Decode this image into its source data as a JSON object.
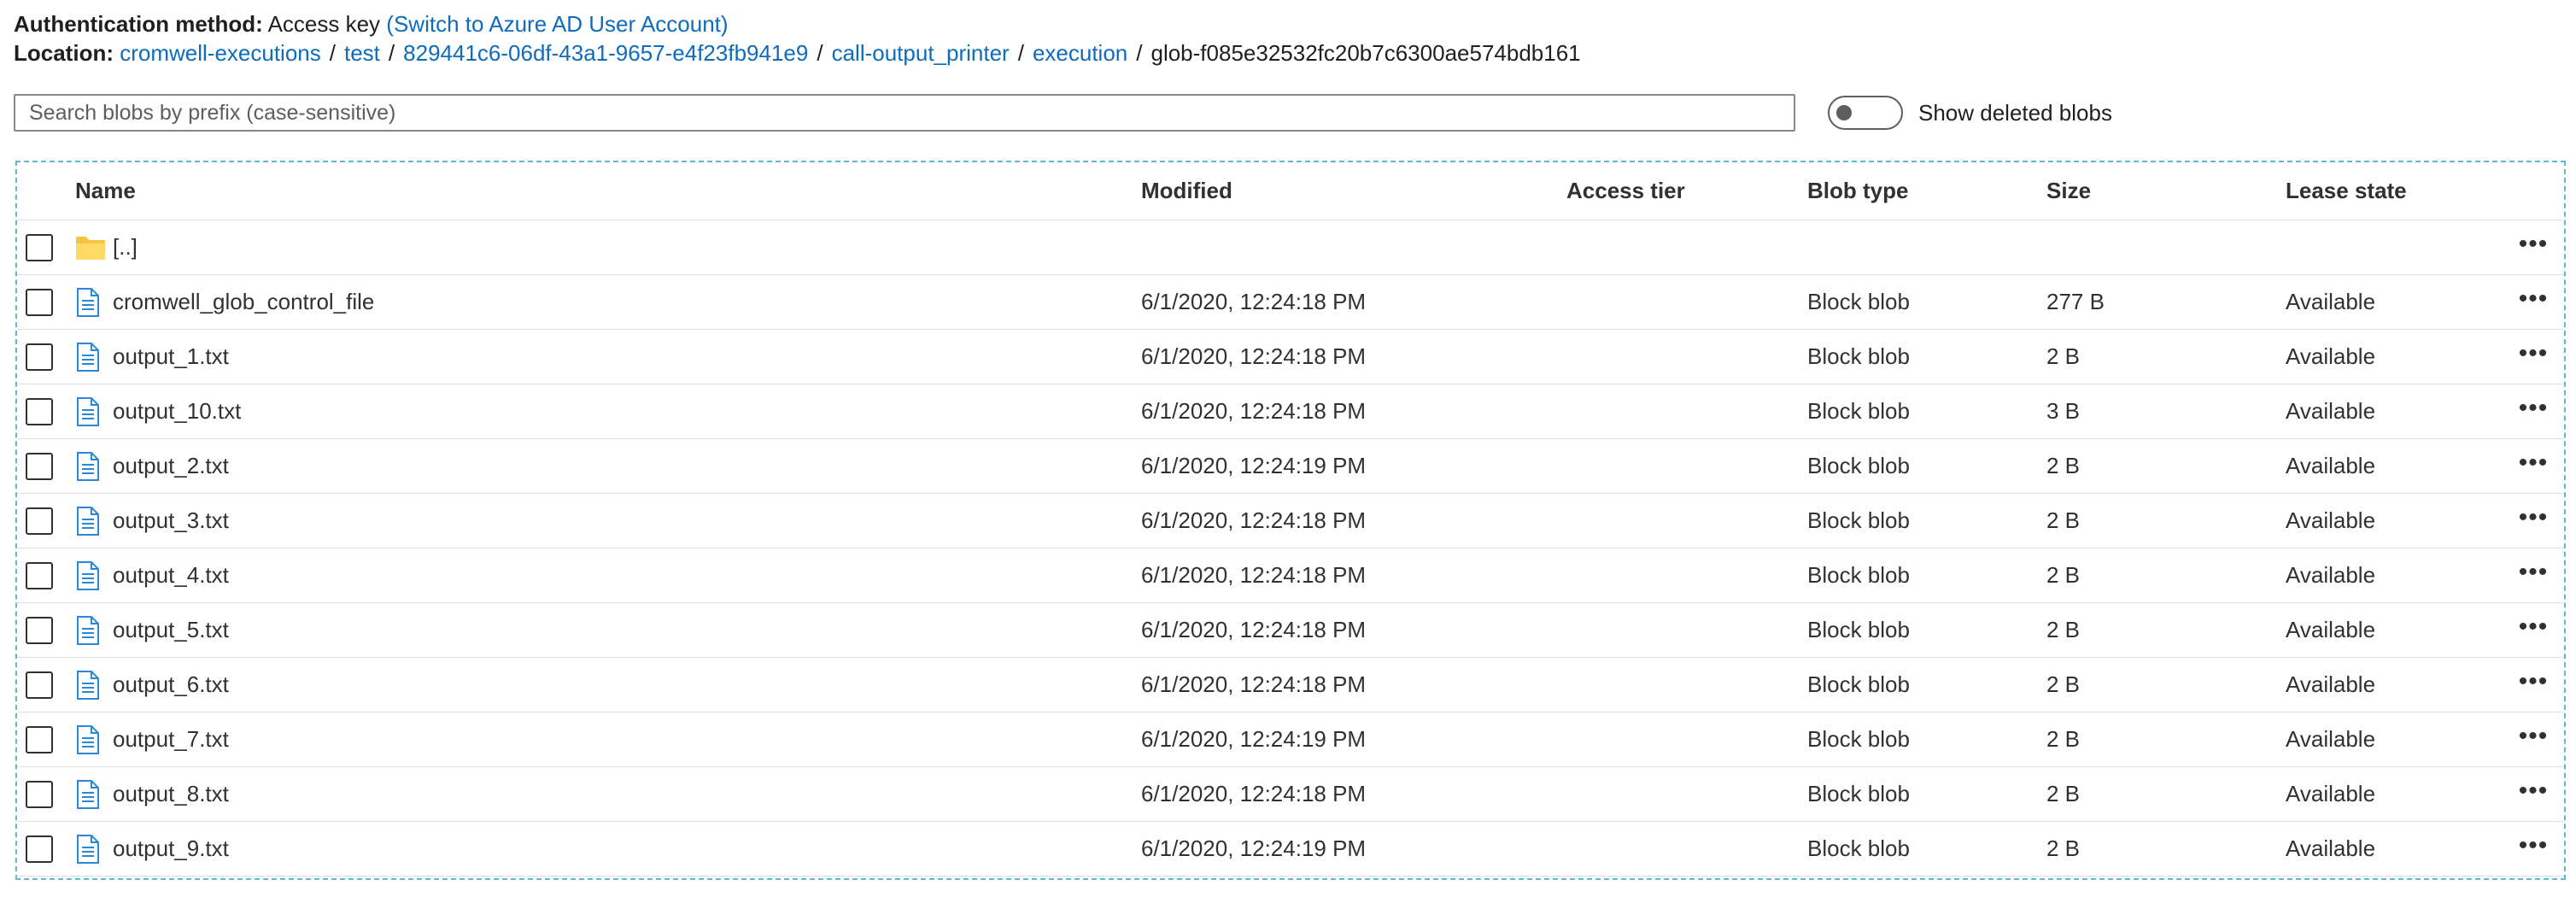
{
  "auth": {
    "label": "Authentication method:",
    "value": "Access key",
    "switch_link": "(Switch to Azure AD User Account)"
  },
  "location": {
    "label": "Location:",
    "crumbs": [
      "cromwell-executions",
      "test",
      "829441c6-06df-43a1-9657-e4f23fb941e9",
      "call-output_printer",
      "execution"
    ],
    "current": "glob-f085e32532fc20b7c6300ae574bdb161"
  },
  "search": {
    "placeholder": "Search blobs by prefix (case-sensitive)",
    "value": ""
  },
  "toggle": {
    "label": "Show deleted blobs",
    "on": false
  },
  "table": {
    "headers": {
      "name": "Name",
      "modified": "Modified",
      "access_tier": "Access tier",
      "blob_type": "Blob type",
      "size": "Size",
      "lease_state": "Lease state"
    },
    "parent_row": {
      "name": "[..]",
      "icon": "folder-icon"
    },
    "rows": [
      {
        "name": "cromwell_glob_control_file",
        "modified": "6/1/2020, 12:24:18 PM",
        "access_tier": "",
        "blob_type": "Block blob",
        "size": "277 B",
        "lease_state": "Available"
      },
      {
        "name": "output_1.txt",
        "modified": "6/1/2020, 12:24:18 PM",
        "access_tier": "",
        "blob_type": "Block blob",
        "size": "2 B",
        "lease_state": "Available"
      },
      {
        "name": "output_10.txt",
        "modified": "6/1/2020, 12:24:18 PM",
        "access_tier": "",
        "blob_type": "Block blob",
        "size": "3 B",
        "lease_state": "Available"
      },
      {
        "name": "output_2.txt",
        "modified": "6/1/2020, 12:24:19 PM",
        "access_tier": "",
        "blob_type": "Block blob",
        "size": "2 B",
        "lease_state": "Available"
      },
      {
        "name": "output_3.txt",
        "modified": "6/1/2020, 12:24:18 PM",
        "access_tier": "",
        "blob_type": "Block blob",
        "size": "2 B",
        "lease_state": "Available"
      },
      {
        "name": "output_4.txt",
        "modified": "6/1/2020, 12:24:18 PM",
        "access_tier": "",
        "blob_type": "Block blob",
        "size": "2 B",
        "lease_state": "Available"
      },
      {
        "name": "output_5.txt",
        "modified": "6/1/2020, 12:24:18 PM",
        "access_tier": "",
        "blob_type": "Block blob",
        "size": "2 B",
        "lease_state": "Available"
      },
      {
        "name": "output_6.txt",
        "modified": "6/1/2020, 12:24:18 PM",
        "access_tier": "",
        "blob_type": "Block blob",
        "size": "2 B",
        "lease_state": "Available"
      },
      {
        "name": "output_7.txt",
        "modified": "6/1/2020, 12:24:19 PM",
        "access_tier": "",
        "blob_type": "Block blob",
        "size": "2 B",
        "lease_state": "Available"
      },
      {
        "name": "output_8.txt",
        "modified": "6/1/2020, 12:24:18 PM",
        "access_tier": "",
        "blob_type": "Block blob",
        "size": "2 B",
        "lease_state": "Available"
      },
      {
        "name": "output_9.txt",
        "modified": "6/1/2020, 12:24:19 PM",
        "access_tier": "",
        "blob_type": "Block blob",
        "size": "2 B",
        "lease_state": "Available"
      }
    ],
    "more_label": "•••",
    "file_icon": "file-icon"
  },
  "colors": {
    "link": "#0f6cbd",
    "text": "#323130",
    "focus_border": "#63b7d6",
    "row_divider": "#e1dfdd",
    "folder": "#f4c542",
    "file_icon": "#2b88d8"
  }
}
